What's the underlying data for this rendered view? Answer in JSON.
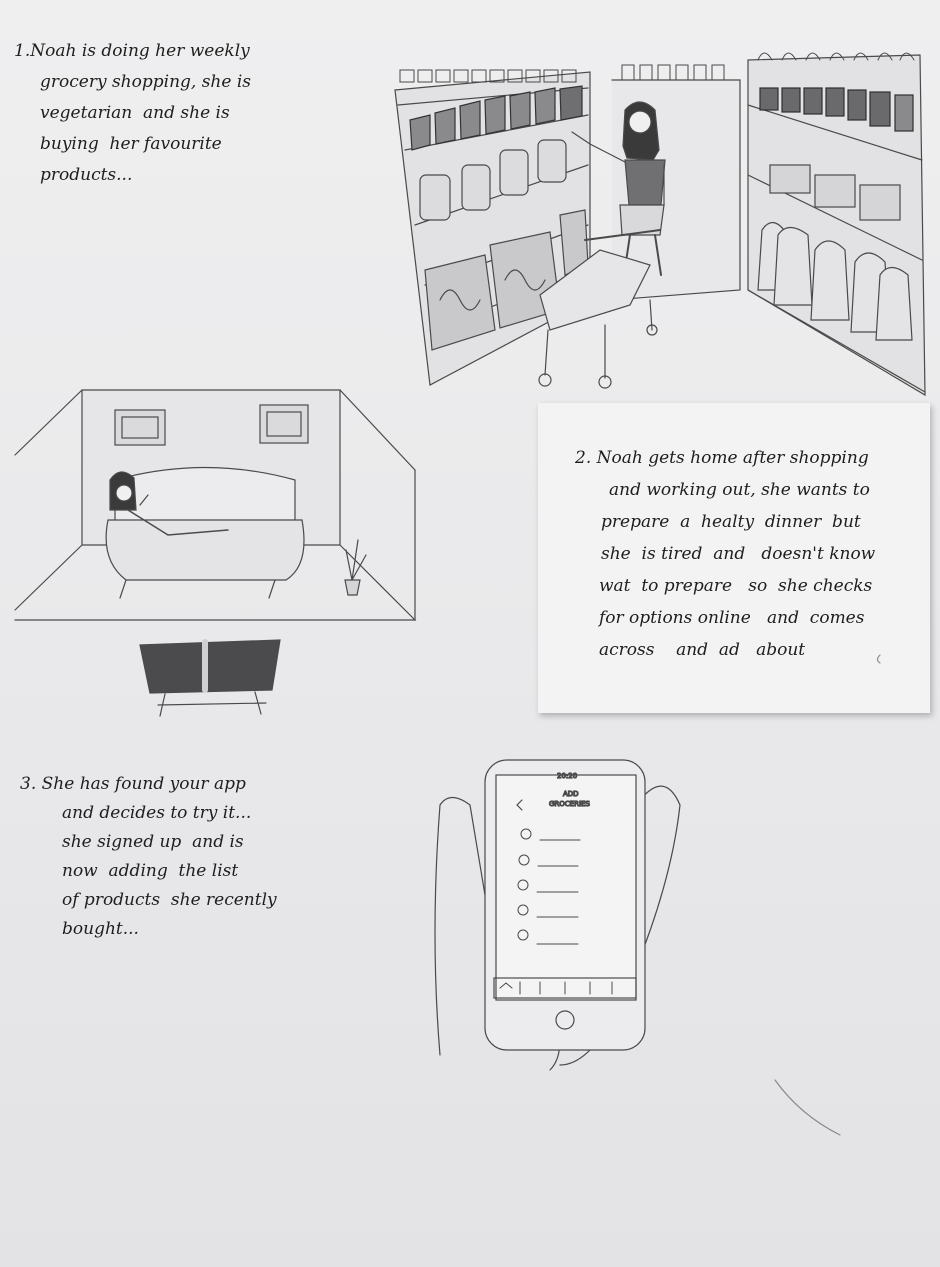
{
  "panels": [
    {
      "number": "1.",
      "caption_lines": [
        "Noah is doing her weekly",
        "grocery shopping, she is",
        "vegetarian  and she is",
        "buying  her favourite",
        "products..."
      ],
      "illustration": "woman-in-grocery-store-sketch"
    },
    {
      "number": "2.",
      "caption_lines": [
        "Noah gets home after shopping",
        "and working out, she wants to",
        "prepare  a  healty  dinner  but",
        "she  is tired  and   doesn't know",
        "wat  to prepare   so  she checks",
        "for options online   and  comes",
        "across    and  ad   about"
      ],
      "illustration": "woman-on-sofa-sketch"
    },
    {
      "number": "3.",
      "caption_lines": [
        "She has found your app",
        "and decides to try it...",
        "she signed up  and is",
        "now  adding  the list",
        "of products  she recently",
        "bought..."
      ],
      "illustration": "hand-holding-phone-sketch",
      "phone": {
        "time": "20:20",
        "title_line1": "ADD",
        "title_line2": "GROCERIES"
      }
    }
  ]
}
